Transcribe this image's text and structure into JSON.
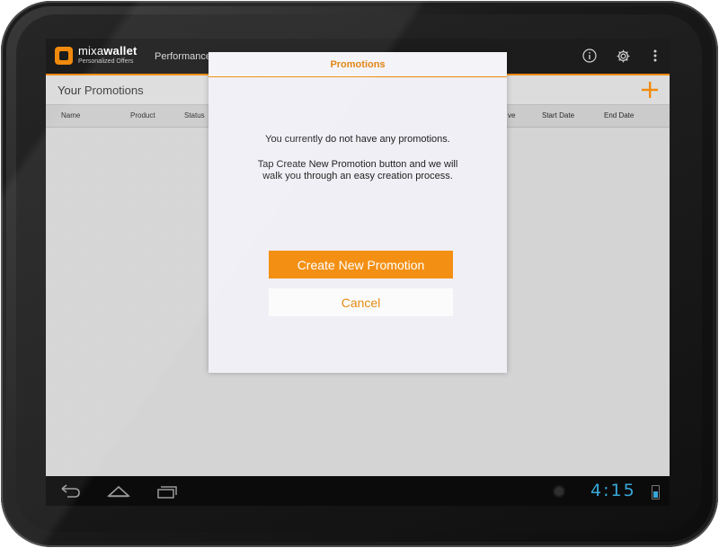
{
  "app": {
    "brand_light": "mixa",
    "brand_bold": "wallet",
    "tagline": "Personalized Offers",
    "tab": "Performance"
  },
  "icons": {
    "info": "info-icon",
    "settings": "gear-icon",
    "overflow": "overflow-menu-icon",
    "add": "plus-icon",
    "back": "back-icon",
    "home": "home-icon",
    "recents": "recent-apps-icon"
  },
  "subheader": {
    "title": "Your Promotions"
  },
  "columns": {
    "name": "Name",
    "product": "Product",
    "status": "Status",
    "type_fragment": "ve",
    "start_date": "Start Date",
    "end_date": "End Date"
  },
  "dialog": {
    "title": "Promotions",
    "message_line1": "You currently do not have any promotions.",
    "message_line2": "Tap Create New Promotion button and we will",
    "message_line3": "walk you through an easy creation process.",
    "create_label": "Create New Promotion",
    "cancel_label": "Cancel"
  },
  "status_bar": {
    "time": "4:15",
    "battery_level": 0.6
  },
  "colors": {
    "accent": "#f39014",
    "clock": "#38a7d8"
  }
}
